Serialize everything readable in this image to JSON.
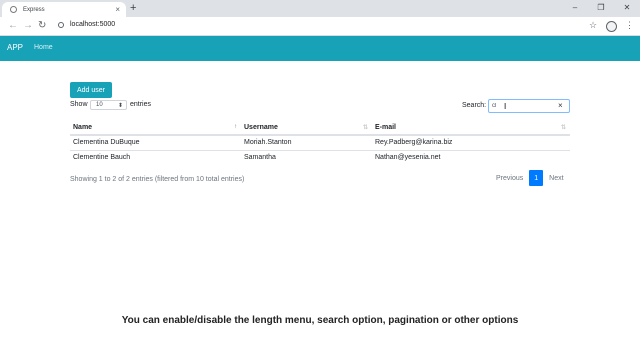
{
  "browser": {
    "tab_title": "Express",
    "url": "localhost:5000",
    "new_tab": "+",
    "close_tab": "×",
    "back": "←",
    "forward": "→",
    "reload": "↻",
    "star": "☆",
    "menu": "⋮",
    "window": {
      "minimize": "–",
      "maximize": "❐",
      "close": "✕"
    }
  },
  "navbar": {
    "brand": "APP",
    "home": "Home"
  },
  "toolbar": {
    "add_user": "Add user"
  },
  "length": {
    "show": "Show",
    "value": "10",
    "entries": "entries"
  },
  "search": {
    "label": "Search:",
    "value": "cl",
    "clear": "×"
  },
  "table": {
    "headers": [
      "Name",
      "Username",
      "E-mail"
    ],
    "rows": [
      [
        "Clementina DuBuque",
        "Moriah.Stanton",
        "Rey.Padberg@karina.biz"
      ],
      [
        "Clementine Bauch",
        "Samantha",
        "Nathan@yesenia.net"
      ]
    ]
  },
  "info": "Showing 1 to 2 of 2 entries (filtered from 10 total entries)",
  "pagination": {
    "previous": "Previous",
    "page": "1",
    "next": "Next"
  },
  "caption": "You can enable/disable the length menu, search option, pagination or other options",
  "colors": {
    "accent": "#17a2b8",
    "active_page": "#007bff"
  }
}
